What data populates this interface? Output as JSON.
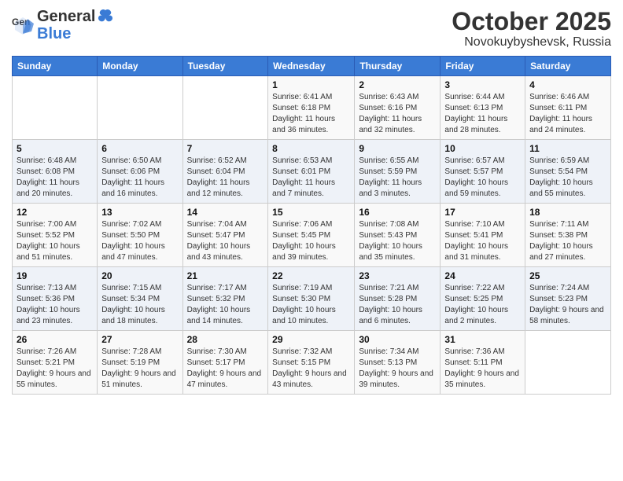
{
  "header": {
    "logo_general": "General",
    "logo_blue": "Blue",
    "month": "October 2025",
    "location": "Novokuybyshevsk, Russia"
  },
  "days_of_week": [
    "Sunday",
    "Monday",
    "Tuesday",
    "Wednesday",
    "Thursday",
    "Friday",
    "Saturday"
  ],
  "weeks": [
    [
      {
        "day": "",
        "sunrise": "",
        "sunset": "",
        "daylight": ""
      },
      {
        "day": "",
        "sunrise": "",
        "sunset": "",
        "daylight": ""
      },
      {
        "day": "",
        "sunrise": "",
        "sunset": "",
        "daylight": ""
      },
      {
        "day": "1",
        "sunrise": "Sunrise: 6:41 AM",
        "sunset": "Sunset: 6:18 PM",
        "daylight": "Daylight: 11 hours and 36 minutes."
      },
      {
        "day": "2",
        "sunrise": "Sunrise: 6:43 AM",
        "sunset": "Sunset: 6:16 PM",
        "daylight": "Daylight: 11 hours and 32 minutes."
      },
      {
        "day": "3",
        "sunrise": "Sunrise: 6:44 AM",
        "sunset": "Sunset: 6:13 PM",
        "daylight": "Daylight: 11 hours and 28 minutes."
      },
      {
        "day": "4",
        "sunrise": "Sunrise: 6:46 AM",
        "sunset": "Sunset: 6:11 PM",
        "daylight": "Daylight: 11 hours and 24 minutes."
      }
    ],
    [
      {
        "day": "5",
        "sunrise": "Sunrise: 6:48 AM",
        "sunset": "Sunset: 6:08 PM",
        "daylight": "Daylight: 11 hours and 20 minutes."
      },
      {
        "day": "6",
        "sunrise": "Sunrise: 6:50 AM",
        "sunset": "Sunset: 6:06 PM",
        "daylight": "Daylight: 11 hours and 16 minutes."
      },
      {
        "day": "7",
        "sunrise": "Sunrise: 6:52 AM",
        "sunset": "Sunset: 6:04 PM",
        "daylight": "Daylight: 11 hours and 12 minutes."
      },
      {
        "day": "8",
        "sunrise": "Sunrise: 6:53 AM",
        "sunset": "Sunset: 6:01 PM",
        "daylight": "Daylight: 11 hours and 7 minutes."
      },
      {
        "day": "9",
        "sunrise": "Sunrise: 6:55 AM",
        "sunset": "Sunset: 5:59 PM",
        "daylight": "Daylight: 11 hours and 3 minutes."
      },
      {
        "day": "10",
        "sunrise": "Sunrise: 6:57 AM",
        "sunset": "Sunset: 5:57 PM",
        "daylight": "Daylight: 10 hours and 59 minutes."
      },
      {
        "day": "11",
        "sunrise": "Sunrise: 6:59 AM",
        "sunset": "Sunset: 5:54 PM",
        "daylight": "Daylight: 10 hours and 55 minutes."
      }
    ],
    [
      {
        "day": "12",
        "sunrise": "Sunrise: 7:00 AM",
        "sunset": "Sunset: 5:52 PM",
        "daylight": "Daylight: 10 hours and 51 minutes."
      },
      {
        "day": "13",
        "sunrise": "Sunrise: 7:02 AM",
        "sunset": "Sunset: 5:50 PM",
        "daylight": "Daylight: 10 hours and 47 minutes."
      },
      {
        "day": "14",
        "sunrise": "Sunrise: 7:04 AM",
        "sunset": "Sunset: 5:47 PM",
        "daylight": "Daylight: 10 hours and 43 minutes."
      },
      {
        "day": "15",
        "sunrise": "Sunrise: 7:06 AM",
        "sunset": "Sunset: 5:45 PM",
        "daylight": "Daylight: 10 hours and 39 minutes."
      },
      {
        "day": "16",
        "sunrise": "Sunrise: 7:08 AM",
        "sunset": "Sunset: 5:43 PM",
        "daylight": "Daylight: 10 hours and 35 minutes."
      },
      {
        "day": "17",
        "sunrise": "Sunrise: 7:10 AM",
        "sunset": "Sunset: 5:41 PM",
        "daylight": "Daylight: 10 hours and 31 minutes."
      },
      {
        "day": "18",
        "sunrise": "Sunrise: 7:11 AM",
        "sunset": "Sunset: 5:38 PM",
        "daylight": "Daylight: 10 hours and 27 minutes."
      }
    ],
    [
      {
        "day": "19",
        "sunrise": "Sunrise: 7:13 AM",
        "sunset": "Sunset: 5:36 PM",
        "daylight": "Daylight: 10 hours and 23 minutes."
      },
      {
        "day": "20",
        "sunrise": "Sunrise: 7:15 AM",
        "sunset": "Sunset: 5:34 PM",
        "daylight": "Daylight: 10 hours and 18 minutes."
      },
      {
        "day": "21",
        "sunrise": "Sunrise: 7:17 AM",
        "sunset": "Sunset: 5:32 PM",
        "daylight": "Daylight: 10 hours and 14 minutes."
      },
      {
        "day": "22",
        "sunrise": "Sunrise: 7:19 AM",
        "sunset": "Sunset: 5:30 PM",
        "daylight": "Daylight: 10 hours and 10 minutes."
      },
      {
        "day": "23",
        "sunrise": "Sunrise: 7:21 AM",
        "sunset": "Sunset: 5:28 PM",
        "daylight": "Daylight: 10 hours and 6 minutes."
      },
      {
        "day": "24",
        "sunrise": "Sunrise: 7:22 AM",
        "sunset": "Sunset: 5:25 PM",
        "daylight": "Daylight: 10 hours and 2 minutes."
      },
      {
        "day": "25",
        "sunrise": "Sunrise: 7:24 AM",
        "sunset": "Sunset: 5:23 PM",
        "daylight": "Daylight: 9 hours and 58 minutes."
      }
    ],
    [
      {
        "day": "26",
        "sunrise": "Sunrise: 7:26 AM",
        "sunset": "Sunset: 5:21 PM",
        "daylight": "Daylight: 9 hours and 55 minutes."
      },
      {
        "day": "27",
        "sunrise": "Sunrise: 7:28 AM",
        "sunset": "Sunset: 5:19 PM",
        "daylight": "Daylight: 9 hours and 51 minutes."
      },
      {
        "day": "28",
        "sunrise": "Sunrise: 7:30 AM",
        "sunset": "Sunset: 5:17 PM",
        "daylight": "Daylight: 9 hours and 47 minutes."
      },
      {
        "day": "29",
        "sunrise": "Sunrise: 7:32 AM",
        "sunset": "Sunset: 5:15 PM",
        "daylight": "Daylight: 9 hours and 43 minutes."
      },
      {
        "day": "30",
        "sunrise": "Sunrise: 7:34 AM",
        "sunset": "Sunset: 5:13 PM",
        "daylight": "Daylight: 9 hours and 39 minutes."
      },
      {
        "day": "31",
        "sunrise": "Sunrise: 7:36 AM",
        "sunset": "Sunset: 5:11 PM",
        "daylight": "Daylight: 9 hours and 35 minutes."
      },
      {
        "day": "",
        "sunrise": "",
        "sunset": "",
        "daylight": ""
      }
    ]
  ]
}
